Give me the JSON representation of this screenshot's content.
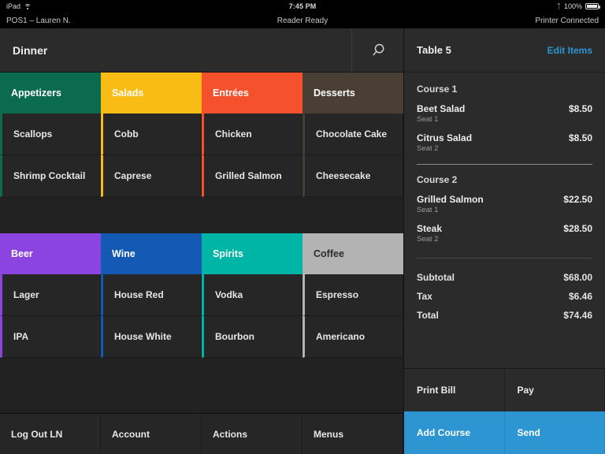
{
  "colors": {
    "accent_blue": "#2e95d3",
    "appetizers": "#0b6b4f",
    "salads": "#f9bc15",
    "entrees": "#f4512c",
    "desserts": "#4a3f35",
    "beer": "#8c44e0",
    "wine": "#1459b3",
    "spirits": "#00b5a5",
    "coffee": "#b3b3b3"
  },
  "status_bar": {
    "device": "iPad",
    "wifi_icon": "wifi-icon",
    "time": "7:45 PM",
    "bluetooth_icon": "bluetooth-icon",
    "battery_percent": "100%",
    "battery_icon": "battery-full-icon"
  },
  "app_bar": {
    "terminal_user": "POS1 – Lauren N.",
    "reader_status": "Reader Ready",
    "printer_status": "Printer Connected"
  },
  "menu": {
    "title": "Dinner",
    "search_icon": "search-icon",
    "categories": [
      {
        "name": "Appetizers",
        "color": "#0b6b4f",
        "items": [
          "Scallops",
          "Shrimp Cocktail"
        ]
      },
      {
        "name": "Salads",
        "color": "#f9bc15",
        "items": [
          "Cobb",
          "Caprese"
        ]
      },
      {
        "name": "Entrées",
        "color": "#f4512c",
        "items": [
          "Chicken",
          "Grilled Salmon"
        ]
      },
      {
        "name": "Desserts",
        "color": "#4a3f35",
        "items": [
          "Chocolate Cake",
          "Cheesecake"
        ]
      }
    ],
    "drink_categories": [
      {
        "name": "Beer",
        "color": "#8c44e0",
        "items": [
          "Lager",
          "IPA"
        ]
      },
      {
        "name": "Wine",
        "color": "#1459b3",
        "items": [
          "House Red",
          "House White"
        ]
      },
      {
        "name": "Spirits",
        "color": "#00b5a5",
        "items": [
          "Vodka",
          "Bourbon"
        ]
      },
      {
        "name": "Coffee",
        "color": "#b3b3b3",
        "items": [
          "Espresso",
          "Americano"
        ]
      }
    ]
  },
  "bottom_nav": [
    {
      "label": "Log Out LN"
    },
    {
      "label": "Account"
    },
    {
      "label": "Actions"
    },
    {
      "label": "Menus"
    }
  ],
  "check": {
    "table_label": "Table 5",
    "edit_items_label": "Edit Items",
    "courses": [
      {
        "label": "Course 1",
        "items": [
          {
            "name": "Beet Salad",
            "seat": "Seat 1",
            "price": "$8.50"
          },
          {
            "name": "Citrus Salad",
            "seat": "Seat 2",
            "price": "$8.50"
          }
        ]
      },
      {
        "label": "Course 2",
        "items": [
          {
            "name": "Grilled Salmon",
            "seat": "Seat 1",
            "price": "$22.50"
          },
          {
            "name": "Steak",
            "seat": "Seat 2",
            "price": "$28.50"
          }
        ]
      }
    ],
    "totals": [
      {
        "label": "Subtotal",
        "value": "$68.00"
      },
      {
        "label": "Tax",
        "value": "$6.46"
      },
      {
        "label": "Total",
        "value": "$74.46"
      }
    ],
    "actions": [
      {
        "label": "Print Bill",
        "primary": false
      },
      {
        "label": "Pay",
        "primary": false
      },
      {
        "label": "Add Course",
        "primary": true
      },
      {
        "label": "Send",
        "primary": true
      }
    ]
  }
}
